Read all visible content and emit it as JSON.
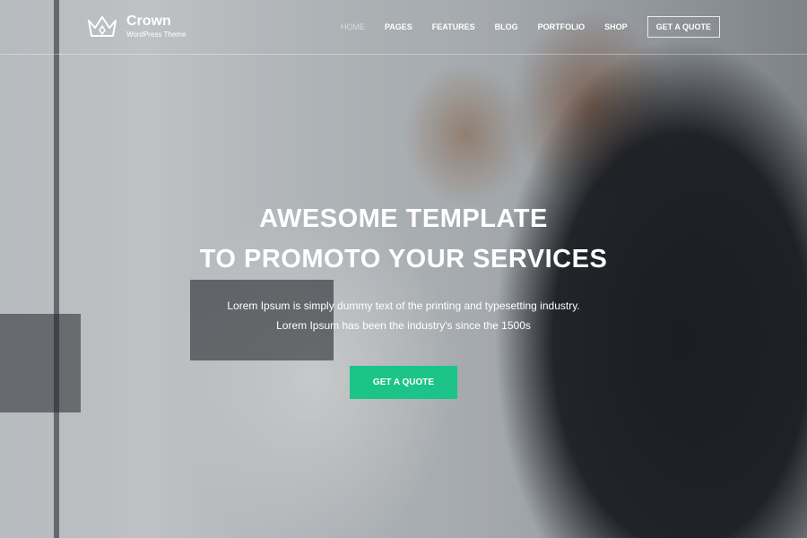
{
  "brand": {
    "name": "Crown",
    "tagline": "WordPress Theme",
    "logo_icon": "crown-icon"
  },
  "nav": {
    "items": [
      {
        "label": "HOME",
        "active": true
      },
      {
        "label": "PAGES",
        "active": false
      },
      {
        "label": "FEATURES",
        "active": false
      },
      {
        "label": "BLOG",
        "active": false
      },
      {
        "label": "PORTFOLIO",
        "active": false
      },
      {
        "label": "SHOP",
        "active": false
      }
    ],
    "cta_label": "GET A QUOTE"
  },
  "hero": {
    "title_line1": "AWESOME TEMPLATE",
    "title_line2": "TO PROMOTO YOUR SERVICES",
    "subtitle_line1": "Lorem Ipsum is simply dummy text of the printing and typesetting industry.",
    "subtitle_line2": "Lorem Ipsum has been the industry's since the 1500s",
    "cta_label": "GET A QUOTE"
  },
  "colors": {
    "accent": "#1cc489",
    "text": "#ffffff"
  }
}
